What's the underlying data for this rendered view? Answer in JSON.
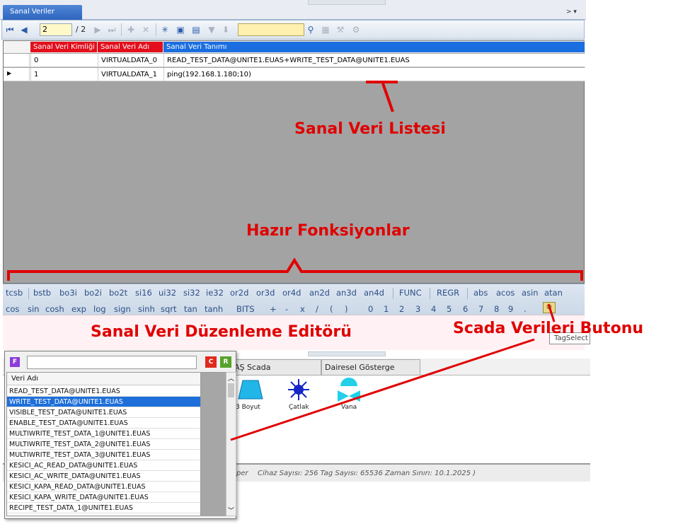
{
  "tab": {
    "title": "Sanal Veriler"
  },
  "toolbar": {
    "page_value": "2",
    "page_total": "/ 2"
  },
  "grid": {
    "headers": [
      "Sanal Veri Kimliği",
      "Sanal Veri Adı",
      "Sanal Veri Tanımı"
    ],
    "rows": [
      [
        "0",
        "VIRTUALDATA_0",
        "READ_TEST_DATA@UNITE1.EUAS+WRITE_TEST_DATA@UNITE1.EUAS"
      ],
      [
        "1",
        "VIRTUALDATA_1",
        "ping(192.168.1.180;10)"
      ]
    ]
  },
  "functions": {
    "row1": [
      "tcsb",
      "bstb",
      "bo3i",
      "bo2i",
      "bo2t",
      "si16",
      "ui32",
      "si32",
      "ie32",
      "or2d",
      "or3d",
      "or4d",
      "an2d",
      "an3d",
      "an4d",
      "FUNC",
      "REGR",
      "abs",
      "acos",
      "asin",
      "atan"
    ],
    "row2": [
      "cos",
      "sin",
      "cosh",
      "exp",
      "log",
      "sign",
      "sinh",
      "sqrt",
      "tan",
      "tanh",
      "BITS",
      "+",
      "-",
      "x",
      "/",
      "(",
      ")",
      "0",
      "1",
      "2",
      "3",
      "4",
      "5",
      "6",
      "7",
      "8",
      "9",
      "."
    ]
  },
  "tooltip": "TagSelect",
  "lower_tabs": [
    "AŞ Scada",
    "Dairesel Gösterge"
  ],
  "symbols": [
    "3 Boyut",
    "Çatlak",
    "Vana"
  ],
  "status": "Cihaz Sayısı: 256   Tag Sayısı: 65536   Zaman Sınırı: 10.1.2025 )",
  "status_prefix": "per",
  "popup": {
    "f_label": "F",
    "c_label": "C",
    "r_label": "R",
    "column": "Veri Adı",
    "items": [
      "READ_TEST_DATA@UNITE1.EUAS",
      "WRITE_TEST_DATA@UNITE1.EUAS",
      "VISIBLE_TEST_DATA@UNITE1.EUAS",
      "ENABLE_TEST_DATA@UNITE1.EUAS",
      "MULTIWRITE_TEST_DATA_1@UNITE1.EUAS",
      "MULTIWRITE_TEST_DATA_2@UNITE1.EUAS",
      "MULTIWRITE_TEST_DATA_3@UNITE1.EUAS",
      "KESICI_AC_READ_DATA@UNITE1.EUAS",
      "KESICI_AC_WRITE_DATA@UNITE1.EUAS",
      "KESICI_KAPA_READ_DATA@UNITE1.EUAS",
      "KESICI_KAPA_WRITE_DATA@UNITE1.EUAS",
      "RECIPE_TEST_DATA_1@UNITE1.EUAS"
    ],
    "selected_index": 1
  },
  "annotations": {
    "list": "Sanal Veri Listesi",
    "functions": "Hazır Fonksiyonlar",
    "editor": "Sanal Veri Düzenleme Editörü",
    "button": "Scada Verileri Butonu"
  },
  "colors": {
    "annotation": "#e00000",
    "header": "#e30f1c",
    "selection": "#1e6fd9"
  }
}
